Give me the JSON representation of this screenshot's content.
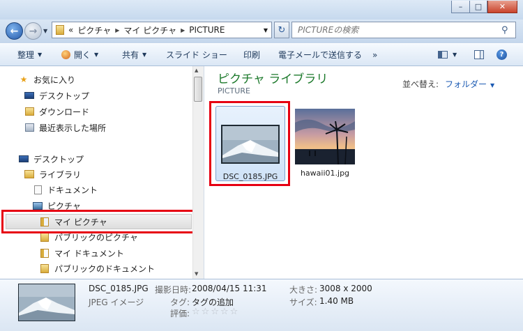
{
  "address": {
    "overflow": "«",
    "segments": [
      "ピクチャ",
      "マイ ピクチャ",
      "PICTURE"
    ]
  },
  "search": {
    "placeholder": "PICTUREの検索"
  },
  "toolbar": {
    "organize": "整理",
    "open": "開く",
    "share": "共有",
    "slideshow": "スライド ショー",
    "print": "印刷",
    "email": "電子メールで送信する",
    "more": "»"
  },
  "nav": {
    "favorites": "お気に入り",
    "desktop_fav": "デスクトップ",
    "downloads": "ダウンロード",
    "recent": "最近表示した場所",
    "desktop": "デスクトップ",
    "libraries": "ライブラリ",
    "documents": "ドキュメント",
    "pictures": "ピクチャ",
    "my_pictures": "マイ ピクチャ",
    "public_pictures": "パブリックのピクチャ",
    "my_documents": "マイ ドキュメント",
    "public_documents": "パブリックのドキュメント"
  },
  "library": {
    "title": "ピクチャ ライブラリ",
    "subtitle": "PICTURE",
    "sort_label": "並べ替え:",
    "sort_value": "フォルダー"
  },
  "files": [
    {
      "name": "DSC_0185.JPG"
    },
    {
      "name": "hawaii01.jpg"
    }
  ],
  "details": {
    "filename": "DSC_0185.JPG",
    "type": "JPEG イメージ",
    "date_label": "撮影日時:",
    "date_value": "2008/04/15 11:31",
    "tags_label": "タグ:",
    "tags_value": "タグの追加",
    "rating_label": "評価:",
    "rating": 0,
    "dimensions_label": "大きさ:",
    "dimensions_value": "3008 x 2000",
    "size_label": "サイズ:",
    "size_value": "1.40 MB"
  },
  "colors": {
    "highlight": "#e60012",
    "library_title": "#1d7a2c",
    "link": "#1b5ab3"
  }
}
